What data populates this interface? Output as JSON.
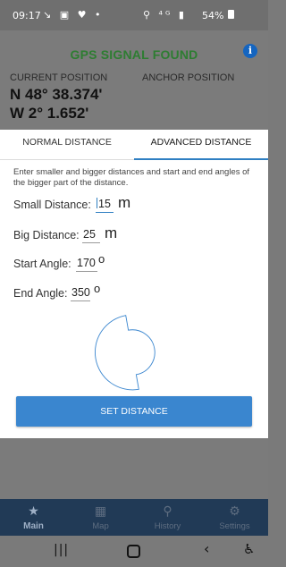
{
  "status_bar": {
    "time": "09:17",
    "left_icons": "↘ ▣ ♥ •",
    "right_icons": "⚲ ⁴ᴳ ▮",
    "battery": "54%"
  },
  "main": {
    "title": "GPS SIGNAL FOUND",
    "info_icon": "i",
    "current_position_label": "CURRENT POSITION",
    "anchor_position_label": "ANCHOR POSITION",
    "latitude": "N 48° 38.374'",
    "longitude": "W 2° 1.652'",
    "title_color": "#2e7d32"
  },
  "dialog": {
    "tabs": [
      {
        "label": "NORMAL DISTANCE",
        "active": false
      },
      {
        "label": "ADVANCED DISTANCE",
        "active": true
      }
    ],
    "instructions": "Enter smaller and bigger distances and start and end angles of the bigger part of the distance.",
    "fields": {
      "small_distance": {
        "label": "Small Distance:",
        "value": "15",
        "unit": "m"
      },
      "big_distance": {
        "label": "Big Distance:",
        "value": "25",
        "unit": "m"
      },
      "start_angle": {
        "label": "Start Angle:",
        "value": "170",
        "unit": "o"
      },
      "end_angle": {
        "label": "End Angle:",
        "value": "350",
        "unit": "o"
      }
    },
    "set_button": "SET DISTANCE",
    "accent_color": "#3a86cf"
  },
  "bottom_nav": [
    {
      "label": "Main",
      "icon": "star-icon",
      "active": true
    },
    {
      "label": "Map",
      "icon": "map-icon",
      "active": false
    },
    {
      "label": "History",
      "icon": "location-pin-icon",
      "active": false
    },
    {
      "label": "Settings",
      "icon": "gear-icon",
      "active": false
    }
  ]
}
